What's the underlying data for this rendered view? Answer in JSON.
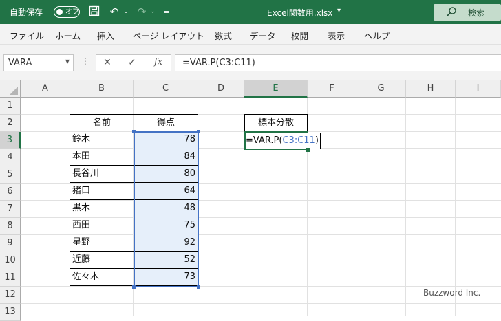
{
  "titlebar": {
    "autosave_label": "自動保存",
    "toggle_text": "オフ",
    "save_icon": "save-icon",
    "undo_icon": "undo-icon",
    "redo_icon": "redo-icon",
    "customize_icon": "customize-qat-icon",
    "document_title": "Excel関数用.xlsx",
    "search_label": "検索",
    "accent": "#217346"
  },
  "ribbon": {
    "tabs": [
      "ファイル",
      "ホーム",
      "挿入",
      "ページ レイアウト",
      "数式",
      "データ",
      "校閲",
      "表示",
      "ヘルプ"
    ]
  },
  "formula_bar": {
    "name_box": "VARA",
    "cancel_icon": "cancel-icon",
    "enter_icon": "enter-icon",
    "fx_label": "fx",
    "formula": "=VAR.P(C3:C11)"
  },
  "sheet": {
    "columns": [
      "A",
      "B",
      "C",
      "D",
      "E",
      "F",
      "G",
      "H",
      "I"
    ],
    "rows": [
      "1",
      "2",
      "3",
      "4",
      "5",
      "6",
      "7",
      "8",
      "9",
      "10",
      "11",
      "12",
      "13"
    ],
    "table_header": {
      "name": "名前",
      "score": "得点"
    },
    "records": [
      {
        "name": "鈴木",
        "score": "78"
      },
      {
        "name": "本田",
        "score": "84"
      },
      {
        "name": "長谷川",
        "score": "80"
      },
      {
        "name": "猪口",
        "score": "64"
      },
      {
        "name": "黒木",
        "score": "48"
      },
      {
        "name": "西田",
        "score": "75"
      },
      {
        "name": "星野",
        "score": "92"
      },
      {
        "name": "近藤",
        "score": "52"
      },
      {
        "name": "佐々木",
        "score": "73"
      }
    ],
    "result_label": "標本分散",
    "edit": {
      "prefix": "=VAR.P(",
      "ref": "C3:C11",
      "suffix": ")"
    },
    "range_color": "#4472c4"
  },
  "watermark": "Buzzword Inc."
}
